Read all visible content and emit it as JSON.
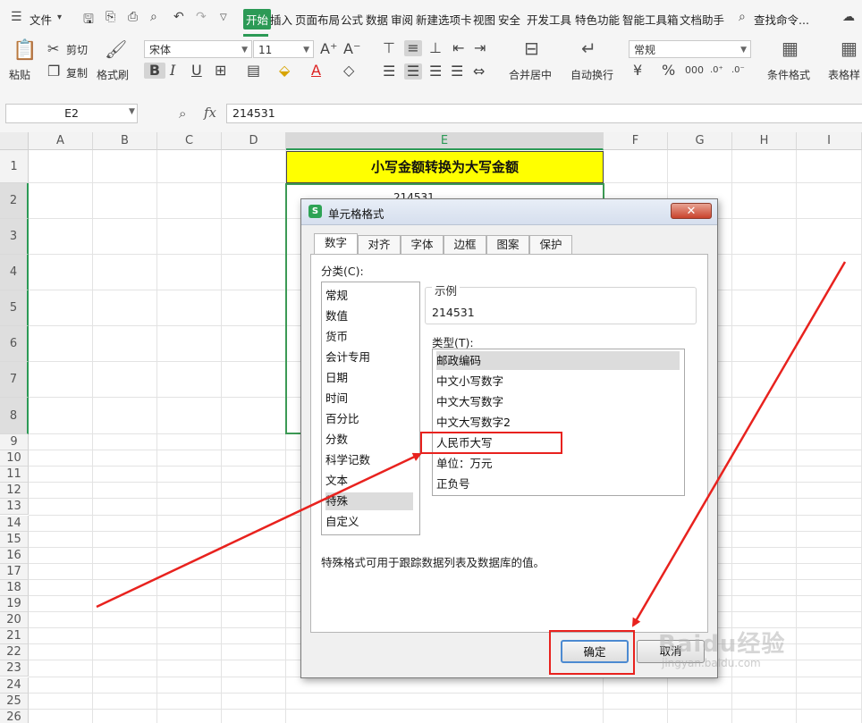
{
  "menu": {
    "file_label": "文件",
    "tabs": [
      "开始",
      "插入",
      "页面布局",
      "公式",
      "数据",
      "审阅",
      "新建选项卡",
      "视图",
      "安全",
      "开发工具",
      "特色功能",
      "智能工具箱",
      "文档助手"
    ],
    "search_label": "查找命令..."
  },
  "ribbon": {
    "paste": "粘贴",
    "cut": "剪切",
    "copy": "复制",
    "format_painter": "格式刷",
    "font_name": "宋体",
    "font_size": "11",
    "merge_center": "合并居中",
    "wrap_text": "自动换行",
    "number_format": "常规",
    "conditional_format": "条件格式",
    "table_style": "表格样"
  },
  "formula_bar": {
    "cell_ref": "E2",
    "fx": "fx",
    "value": "214531"
  },
  "sheet": {
    "columns": [
      "A",
      "B",
      "C",
      "D",
      "E",
      "F",
      "G",
      "H",
      "I"
    ],
    "rows": [
      "1",
      "2",
      "3",
      "4",
      "5",
      "6",
      "7",
      "8",
      "9",
      "10",
      "11",
      "12",
      "13",
      "14",
      "15",
      "16",
      "17",
      "18",
      "19",
      "20",
      "21",
      "22",
      "23",
      "24",
      "25",
      "26"
    ],
    "title_cell": "小写金额转换为大写金额",
    "e2_partial": "214531"
  },
  "dialog": {
    "title": "单元格格式",
    "close": "✕",
    "tabs": [
      "数字",
      "对齐",
      "字体",
      "边框",
      "图案",
      "保护"
    ],
    "category_label": "分类(C):",
    "categories": [
      "常规",
      "数值",
      "货币",
      "会计专用",
      "日期",
      "时间",
      "百分比",
      "分数",
      "科学记数",
      "文本",
      "特殊",
      "自定义"
    ],
    "selected_category": "特殊",
    "sample_label": "示例",
    "sample_value": "214531",
    "type_label": "类型(T):",
    "types": [
      "邮政编码",
      "中文小写数字",
      "中文大写数字",
      "中文大写数字2",
      "人民币大写",
      "单位：万元",
      "正负号"
    ],
    "description": "特殊格式可用于跟踪数据列表及数据库的值。",
    "ok": "确定",
    "cancel": "取消"
  },
  "watermark": {
    "brand": "Baidu经验",
    "url": "jingyan.baidu.com"
  },
  "colors": {
    "accent_green": "#2c9a56",
    "title_fill": "#ffff00",
    "annotation_red": "#e8221e"
  }
}
